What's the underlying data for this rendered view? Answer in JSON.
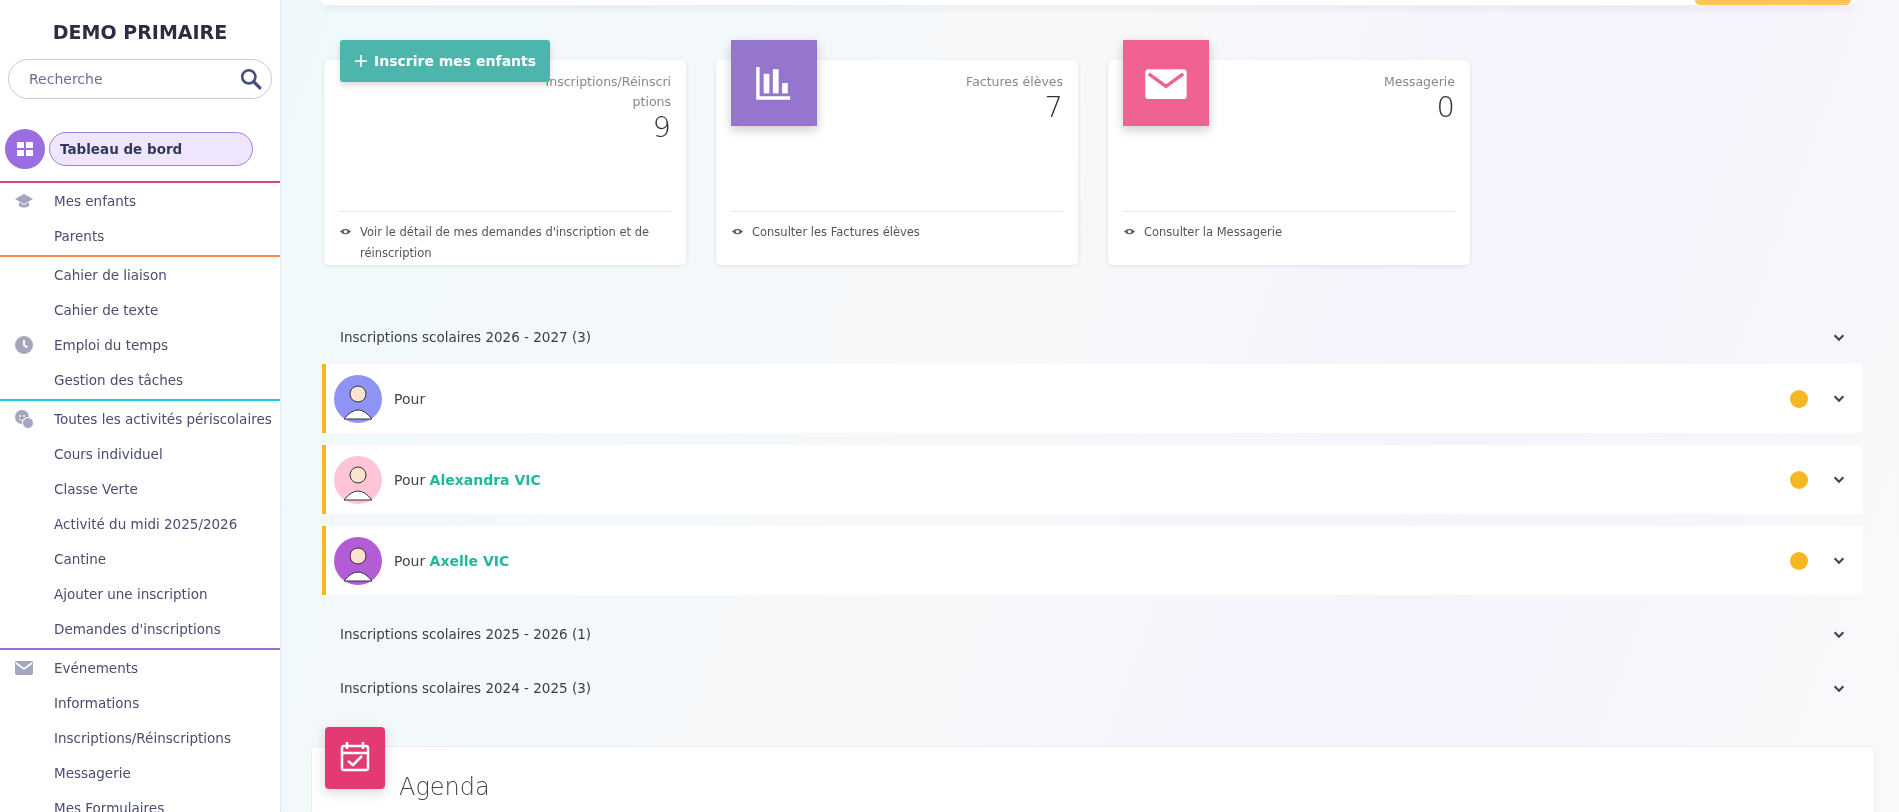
{
  "sidebar": {
    "title": "DEMO PRIMAIRE",
    "search": {
      "placeholder": "Recherche"
    },
    "sections": [
      {
        "color": "#e0417a",
        "items": [
          {
            "label": "Tableau de bord",
            "kind": "dashboard",
            "selected": true
          }
        ]
      },
      {
        "color": "#ff8c4a",
        "items": [
          {
            "label": "Mes enfants",
            "kind": "children",
            "selected": false
          },
          {
            "label": "Parents",
            "selected": false
          }
        ]
      },
      {
        "color": "#1fc8e8",
        "items": [
          {
            "label": "Cahier de liaison",
            "selected": false
          },
          {
            "label": "Cahier de texte",
            "selected": false
          },
          {
            "label": "Emploi du temps",
            "kind": "schedule",
            "selected": false
          },
          {
            "label": "Gestion des tâches",
            "selected": false
          }
        ]
      },
      {
        "color": "#9a6ee0",
        "items": [
          {
            "label": "Toutes les activités périscolaires",
            "kind": "activities",
            "selected": false
          },
          {
            "label": "Cours individuel",
            "selected": false
          },
          {
            "label": "Classe Verte",
            "selected": false
          },
          {
            "label": "Activité du midi 2025/2026",
            "selected": false
          },
          {
            "label": "Cantine",
            "selected": false
          },
          {
            "label": "Ajouter une inscription",
            "selected": false
          },
          {
            "label": "Demandes d'inscriptions",
            "selected": false
          }
        ]
      },
      {
        "items": [
          {
            "label": "Evénements",
            "kind": "events",
            "selected": false
          },
          {
            "label": "Informations",
            "selected": false
          },
          {
            "label": "Inscriptions/Réinscriptions",
            "selected": false
          },
          {
            "label": "Messagerie",
            "selected": false
          },
          {
            "label": "Mes Formulaires",
            "selected": false
          }
        ]
      }
    ]
  },
  "cards": [
    {
      "kind": "button",
      "button": "Inscrire mes enfants",
      "label": "Inscriptions/Réinscriptions",
      "value": "9",
      "link": "Voir le détail de mes demandes d'inscription et de réinscription"
    },
    {
      "kind": "chart",
      "color": "#9575cd",
      "label": "Factures élèves",
      "value": "7",
      "link": "Consulter les Factures élèves"
    },
    {
      "kind": "mail",
      "color": "#f06292",
      "label": "Messagerie",
      "value": "0",
      "link": "Consulter la Messagerie"
    }
  ],
  "registrations": [
    {
      "title": "Inscriptions scolaires 2026 - 2027 (3)",
      "rows": [
        {
          "kind": "boy",
          "prefix": "Pour",
          "color": "#f6b821"
        },
        {
          "kind": "girl",
          "prefix": "Pour",
          "name": "Alexandra VIC",
          "color": "#f6b821"
        },
        {
          "kind": "photo",
          "prefix": "Pour",
          "name": "Axelle VIC",
          "color": "#f6b821"
        }
      ]
    },
    {
      "title": "Inscriptions scolaires 2025 - 2026 (1)"
    },
    {
      "title": "Inscriptions scolaires 2024 - 2025 (3)"
    }
  ],
  "agenda": {
    "title": "Agenda"
  }
}
